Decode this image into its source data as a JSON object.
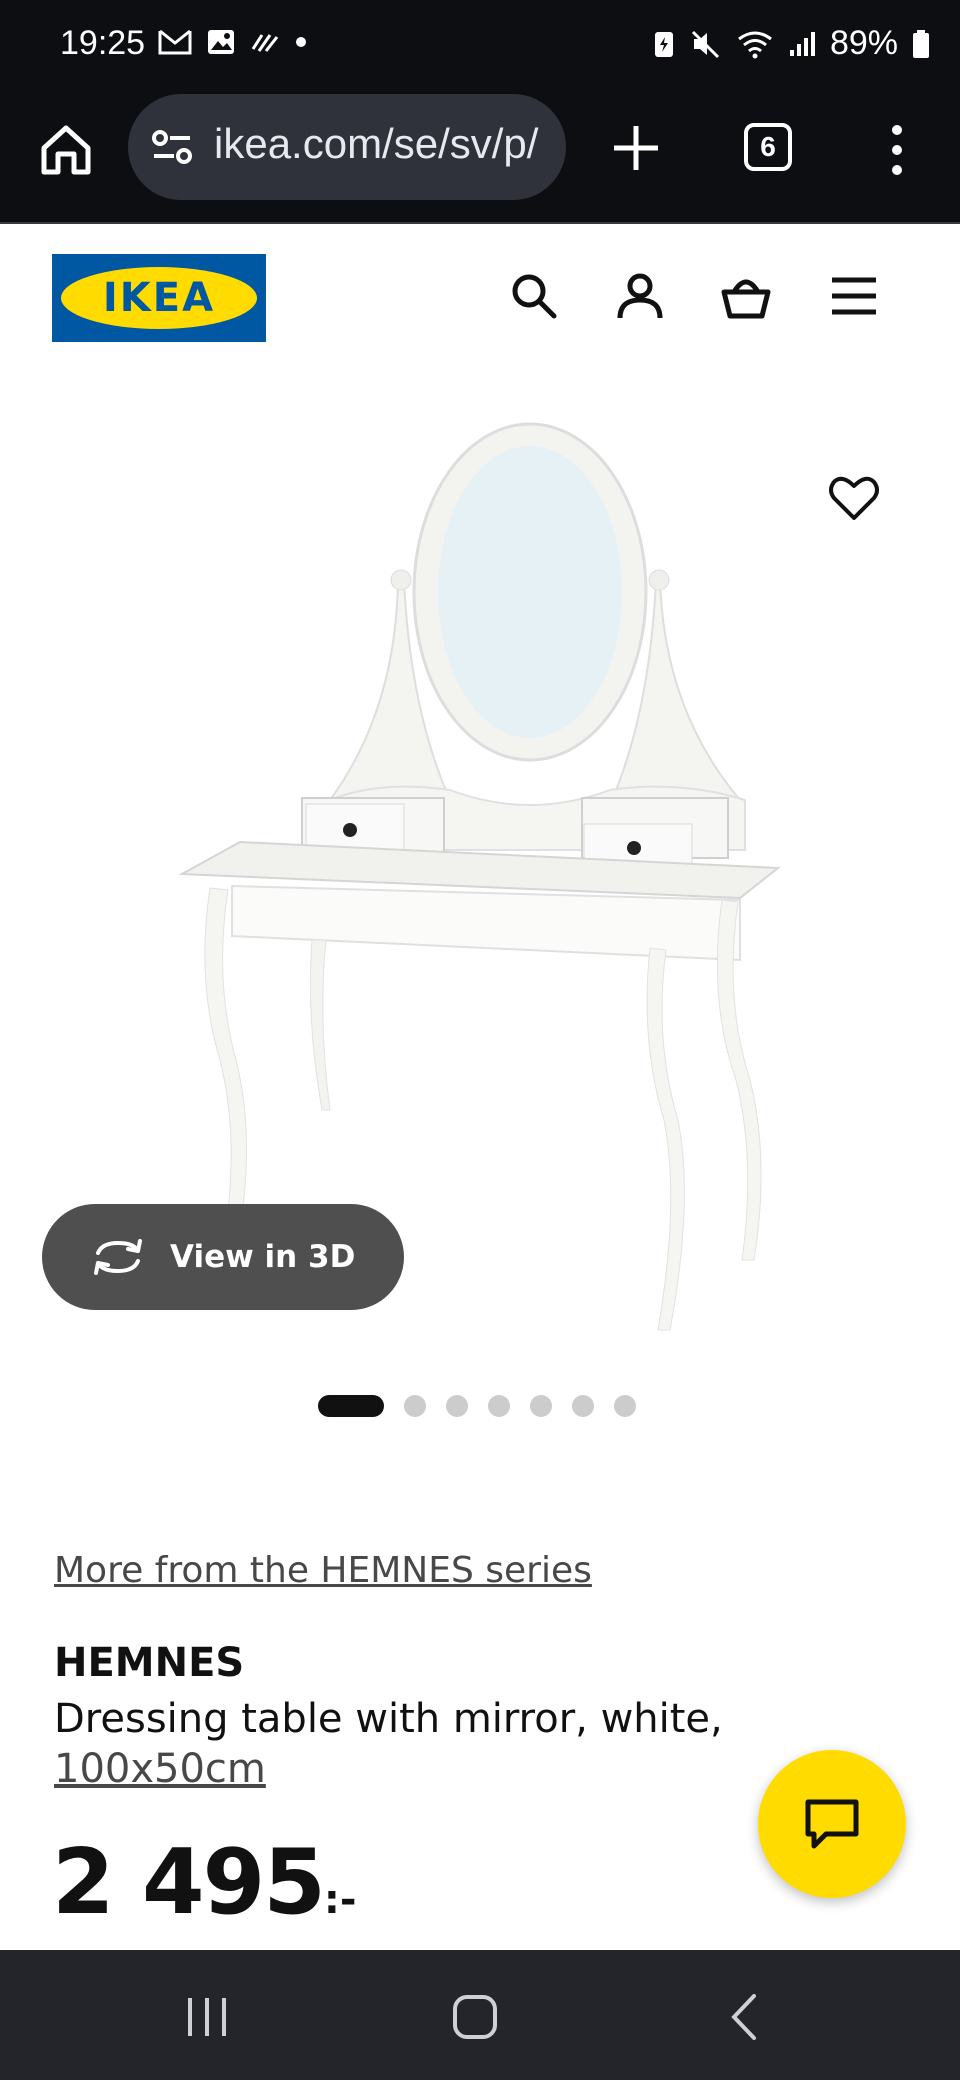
{
  "status_bar": {
    "time": "19:25",
    "battery": "89%"
  },
  "browser": {
    "url": "ikea.com/se/sv/p/",
    "tab_count": "6"
  },
  "header": {
    "logo_text": "IKEA",
    "icons": [
      "search-icon",
      "account-icon",
      "basket-icon",
      "hamburger-menu-icon"
    ]
  },
  "product": {
    "view_3d_label": "View in 3D",
    "carousel_total": 7,
    "carousel_active": 1,
    "series_link": "More from the HEMNES series",
    "name": "HEMNES",
    "description": "Dressing table with mirror, white,",
    "size": "100x50cm",
    "price": "2 495",
    "price_suffix": ":-"
  },
  "colors": {
    "ikea_blue": "#0058a3",
    "ikea_yellow": "#ffdb00"
  }
}
